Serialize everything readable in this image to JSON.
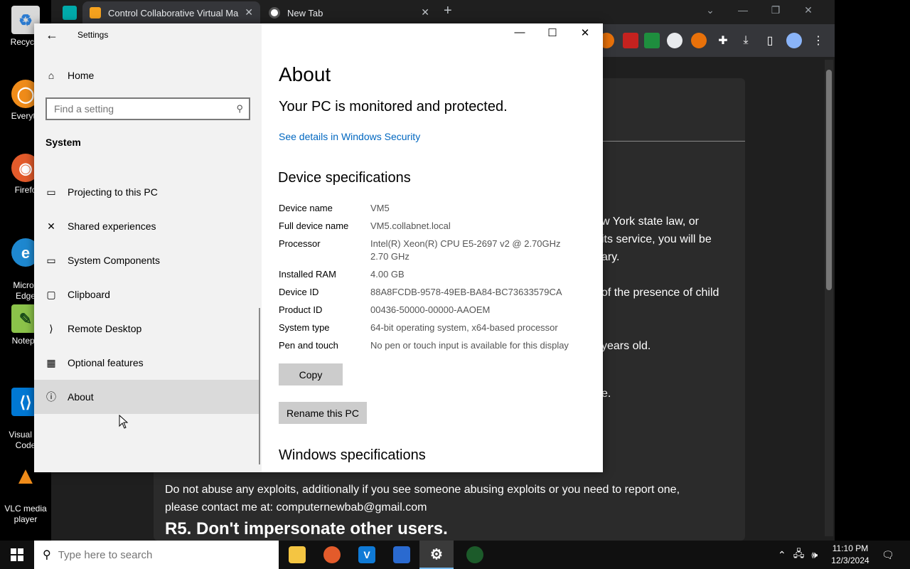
{
  "desktop": {
    "icons": [
      {
        "label": "Recycle",
        "icon": "recycle-bin-icon"
      },
      {
        "label": "Everyth",
        "icon": "everything-search-icon"
      },
      {
        "label": "Firefo",
        "icon": "firefox-icon"
      },
      {
        "label": "Micros\nEdge",
        "icon": "edge-icon"
      },
      {
        "label": "Notepa",
        "icon": "notepadpp-icon"
      },
      {
        "label": "Visual St\nCode",
        "icon": "vscode-icon"
      },
      {
        "label": "VLC media\nplayer",
        "icon": "vlc-icon"
      }
    ]
  },
  "browser": {
    "tabs": [
      {
        "title": "Control Collaborative Virtual Ma",
        "close": "✕"
      },
      {
        "title": "New Tab",
        "close": "✕"
      }
    ],
    "new_tab": "+",
    "window_controls": [
      "⌄",
      "—",
      "❐",
      "✕"
    ],
    "page_text": {
      "line1": "w York state law, or",
      "line2": "its service, you will be",
      "line3": "ary.",
      "line4": "of the presence of child",
      "line5": "years old.",
      "line6": "e.",
      "line7": "Do not abuse any exploits, additionally if you see someone abusing exploits or you need to report one,",
      "line8": "please contact me at: computernewbab@gmail.com",
      "line9": "R5. Don't impersonate other users."
    }
  },
  "settings": {
    "title": "Settings",
    "home": "Home",
    "search_placeholder": "Find a setting",
    "section": "System",
    "nav": [
      {
        "label": "Projecting to this PC",
        "icon": "projector-icon",
        "glyph": "▭"
      },
      {
        "label": "Shared experiences",
        "icon": "shared-experiences-icon",
        "glyph": "✕"
      },
      {
        "label": "System Components",
        "icon": "system-components-icon",
        "glyph": "▭"
      },
      {
        "label": "Clipboard",
        "icon": "clipboard-icon",
        "glyph": "▢"
      },
      {
        "label": "Remote Desktop",
        "icon": "remote-desktop-icon",
        "glyph": "⟩"
      },
      {
        "label": "Optional features",
        "icon": "optional-features-icon",
        "glyph": "▦"
      },
      {
        "label": "About",
        "icon": "info-icon",
        "glyph": "ⓘ"
      }
    ],
    "window_controls": {
      "minimize": "—",
      "maximize": "☐",
      "close": "✕"
    },
    "about": {
      "heading": "About",
      "protection": "Your PC is monitored and protected.",
      "security_link": "See details in Windows Security",
      "device_heading": "Device specifications",
      "specs": [
        {
          "label": "Device name",
          "value": "VM5"
        },
        {
          "label": "Full device name",
          "value": "VM5.collabnet.local"
        },
        {
          "label": "Processor",
          "value": "Intel(R) Xeon(R) CPU E5-2697 v2 @ 2.70GHz\n2.70 GHz"
        },
        {
          "label": "Installed RAM",
          "value": "4.00 GB"
        },
        {
          "label": "Device ID",
          "value": "88A8FCDB-9578-49EB-BA84-BC73633579CA"
        },
        {
          "label": "Product ID",
          "value": "00436-50000-00000-AAOEM"
        },
        {
          "label": "System type",
          "value": "64-bit operating system, x64-based processor"
        },
        {
          "label": "Pen and touch",
          "value": "No pen or touch input is available for this display"
        }
      ],
      "copy_button": "Copy",
      "rename_button": "Rename this PC",
      "windows_heading": "Windows specifications"
    }
  },
  "taskbar": {
    "search_placeholder": "Type here to search",
    "time": "11:10 PM",
    "date": "12/3/2024",
    "apps": [
      "file-explorer-icon",
      "firefox-icon",
      "vs-icon",
      "remote-app-icon",
      "settings-gear-icon",
      "chrome-icon"
    ],
    "tray": [
      "⌃",
      "🖧",
      "🕪",
      "🗨"
    ]
  }
}
